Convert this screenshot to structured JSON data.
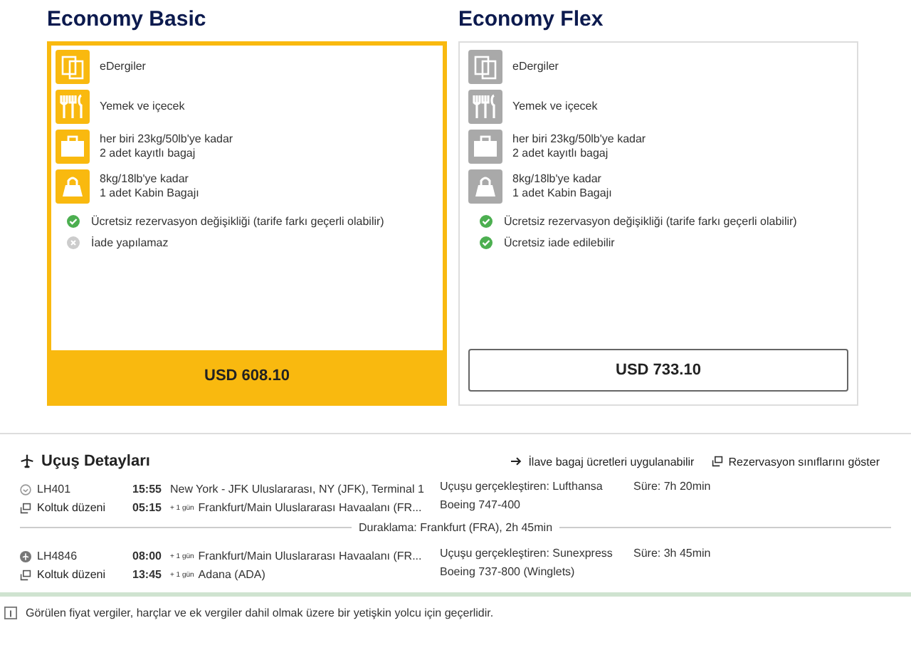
{
  "fares": [
    {
      "title": "Economy Basic",
      "selected": true,
      "features": [
        {
          "kind": "magazine",
          "lines": [
            "eDergiler"
          ]
        },
        {
          "kind": "meal",
          "lines": [
            "Yemek ve içecek"
          ]
        },
        {
          "kind": "suitcase",
          "lines": [
            "her biri 23kg/50lb'ye kadar",
            "2 adet kayıtlı bagaj"
          ]
        },
        {
          "kind": "bag",
          "lines": [
            "8kg/18lb'ye kadar",
            "1 adet Kabin Bagajı"
          ]
        }
      ],
      "conditions": [
        {
          "text": "Ücretsiz rezervasyon değişikliği (tarife farkı geçerli olabilir)",
          "ok": true
        },
        {
          "text": "İade yapılamaz",
          "ok": false
        }
      ],
      "price": "USD 608.10"
    },
    {
      "title": "Economy Flex",
      "selected": false,
      "features": [
        {
          "kind": "magazine",
          "lines": [
            "eDergiler"
          ]
        },
        {
          "kind": "meal",
          "lines": [
            "Yemek ve içecek"
          ]
        },
        {
          "kind": "suitcase",
          "lines": [
            "her biri 23kg/50lb'ye kadar",
            "2 adet kayıtlı bagaj"
          ]
        },
        {
          "kind": "bag",
          "lines": [
            "8kg/18lb'ye kadar",
            "1 adet Kabin Bagajı"
          ]
        }
      ],
      "conditions": [
        {
          "text": "Ücretsiz rezervasyon değişikliği (tarife farkı geçerli olabilir)",
          "ok": true
        },
        {
          "text": "Ücretsiz iade edilebilir",
          "ok": true
        }
      ],
      "price": "USD 733.10"
    }
  ],
  "flight_details": {
    "title": "Uçuş Detayları",
    "links": [
      "İlave bagaj ücretleri uygulanabilir",
      "Rezervasyon sınıflarını göster"
    ],
    "segments": [
      {
        "flight": "LH401",
        "seat_link": "Koltuk düzeni",
        "dep_time": "15:55",
        "dep_place": "New York - JFK Uluslararası, NY (JFK), Terminal 1",
        "arr_time": "05:15",
        "arr_day": "+ 1 gün",
        "arr_place": "Frankfurt/Main Uluslararası Havaalanı (FR...",
        "operator": "Uçuşu gerçekleştiren: Lufthansa",
        "aircraft": "Boeing 747-400",
        "duration": "Süre: 7h 20min",
        "layover": "Duraklama: Frankfurt (FRA), 2h 45min"
      },
      {
        "flight": "LH4846",
        "seat_link": "Koltuk düzeni",
        "dep_time": "08:00",
        "dep_day": "+ 1 gün",
        "dep_place": "Frankfurt/Main Uluslararası Havaalanı (FR...",
        "arr_time": "13:45",
        "arr_day": "+ 1 gün",
        "arr_place": "Adana (ADA)",
        "operator": "Uçuşu gerçekleştiren: Sunexpress",
        "aircraft": "Boeing 737-800 (Winglets)",
        "duration": "Süre: 3h 45min"
      }
    ]
  },
  "footnote": "Görülen fiyat vergiler, harçlar ve ek vergiler dahil olmak üzere bir yetişkin yolcu için geçerlidir."
}
